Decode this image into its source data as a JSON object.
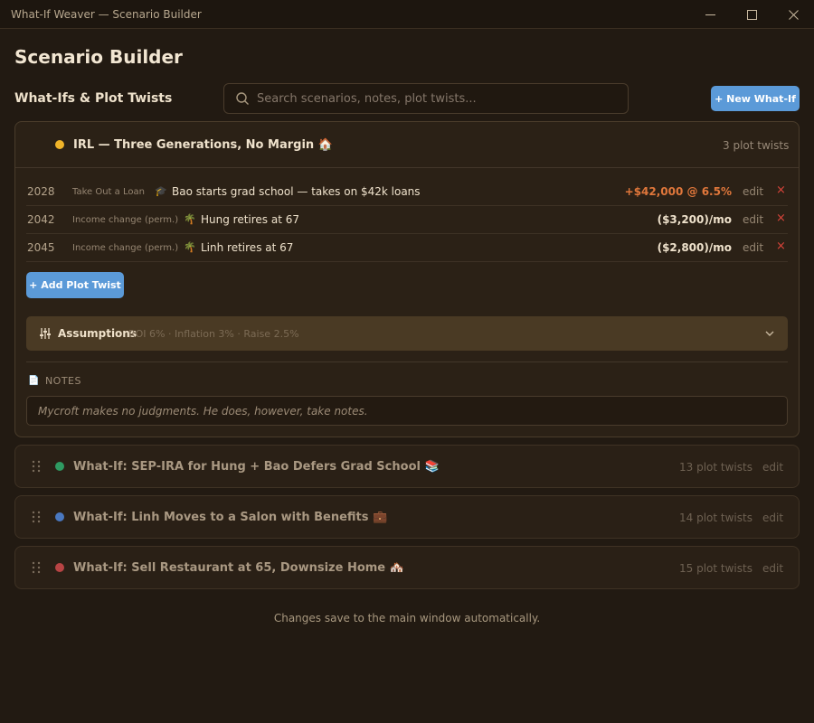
{
  "window": {
    "title": "What-If Weaver — Scenario Builder"
  },
  "page": {
    "title": "Scenario Builder",
    "section_label": "What-Ifs & Plot Twists"
  },
  "search": {
    "placeholder": "Search scenarios, notes, plot twists..."
  },
  "new_button": "+ New What-If",
  "main_scenario": {
    "title": "IRL — Three Generations, No Margin 🏠",
    "dot_color": "#f0b429",
    "count": "3 plot twists",
    "twists": [
      {
        "year": "2028",
        "type": "Take Out a Loan",
        "emoji": "🎓",
        "desc": "Bao starts grad school — takes on $42k loans",
        "amount": "+$42,000 @ 6.5%",
        "amount_color": "#e0773b",
        "edit": "edit",
        "remove": "×"
      },
      {
        "year": "2042",
        "type": "Income change (perm.)",
        "emoji": "🌴",
        "desc": "Hung retires at 67",
        "amount": "($3,200)/mo",
        "amount_color": "#efe2cc",
        "edit": "edit",
        "remove": "×"
      },
      {
        "year": "2045",
        "type": "Income change (perm.)",
        "emoji": "🌴",
        "desc": "Linh retires at 67",
        "amount": "($2,800)/mo",
        "amount_color": "#efe2cc",
        "edit": "edit",
        "remove": "×"
      }
    ],
    "add_button": "+ Add Plot Twist",
    "assumptions": {
      "label": "Assumptions",
      "summary": "ROI 6% · Inflation 3% · Raise 2.5%"
    },
    "notes": {
      "label": "NOTES",
      "text": "Mycroft makes no judgments. He does, however, take notes."
    }
  },
  "other_scenarios": [
    {
      "title": "What-If: SEP-IRA for Hung + Bao Defers Grad School 📚",
      "dot_color": "#2f9a62",
      "count": "13 plot twists",
      "edit": "edit"
    },
    {
      "title": "What-If: Linh Moves to a Salon with Benefits 💼",
      "dot_color": "#4a78c0",
      "count": "14 plot twists",
      "edit": "edit"
    },
    {
      "title": "What-If: Sell Restaurant at 65, Downsize Home 🏘️",
      "dot_color": "#b84444",
      "count": "15 plot twists",
      "edit": "edit"
    }
  ],
  "footer": "Changes save to the main window automatically."
}
